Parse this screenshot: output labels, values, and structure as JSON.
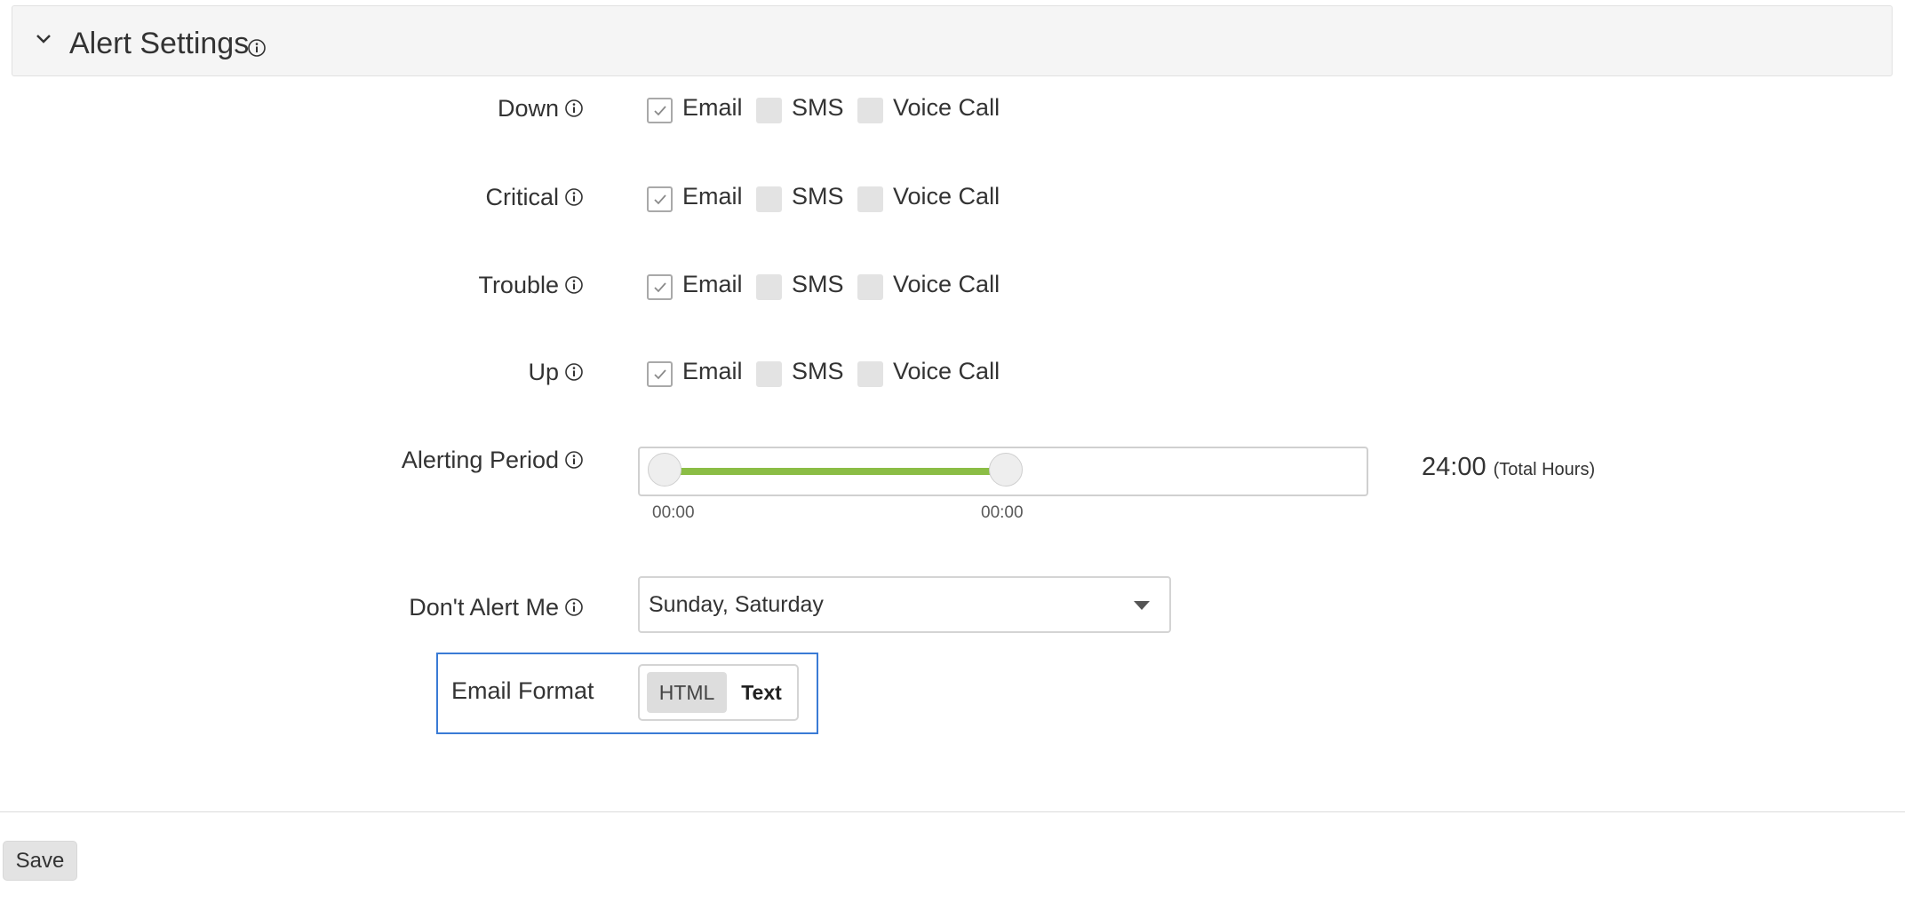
{
  "section": {
    "title": "Alert Settings"
  },
  "rows": [
    {
      "label": "Down",
      "options": [
        {
          "label": "Email",
          "checked": true
        },
        {
          "label": "SMS",
          "checked": false
        },
        {
          "label": "Voice Call",
          "checked": false
        }
      ]
    },
    {
      "label": "Critical",
      "options": [
        {
          "label": "Email",
          "checked": true
        },
        {
          "label": "SMS",
          "checked": false
        },
        {
          "label": "Voice Call",
          "checked": false
        }
      ]
    },
    {
      "label": "Trouble",
      "options": [
        {
          "label": "Email",
          "checked": true
        },
        {
          "label": "SMS",
          "checked": false
        },
        {
          "label": "Voice Call",
          "checked": false
        }
      ]
    },
    {
      "label": "Up",
      "options": [
        {
          "label": "Email",
          "checked": true
        },
        {
          "label": "SMS",
          "checked": false
        },
        {
          "label": "Voice Call",
          "checked": false
        }
      ]
    }
  ],
  "alerting_period": {
    "label": "Alerting Period",
    "start": "00:00",
    "end": "00:00",
    "total": "24:00",
    "total_unit": "(Total Hours)"
  },
  "dont_alert": {
    "label": "Don't Alert Me",
    "value": "Sunday, Saturday"
  },
  "email_format": {
    "label": "Email Format",
    "options": [
      "HTML",
      "Text"
    ],
    "selected": "HTML"
  },
  "save_label": "Save",
  "colors": {
    "accent_green": "#8bbd45",
    "focus_blue": "#3a7bd5"
  },
  "icons": {
    "collapse": "chevron-down-icon",
    "info": "info-icon",
    "check": "check-icon",
    "dropdown": "caret-down-icon"
  }
}
